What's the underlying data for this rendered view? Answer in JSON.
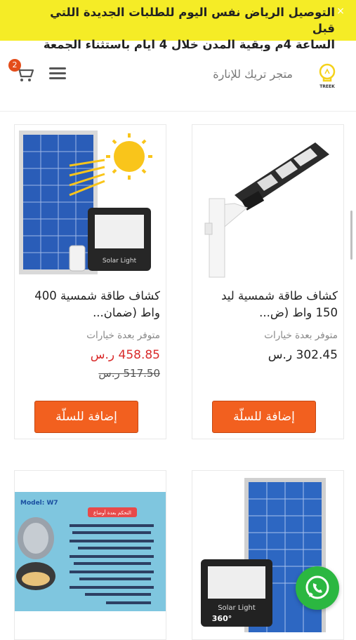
{
  "banner": {
    "message": "التوصيل الرياض نفس اليوم للطلبات الجديدة اللتي قبل\nالساعة 4م وبقية المدن خلال 4 ايام باستثناء الجمعة",
    "close_icon": "×"
  },
  "header": {
    "store_name": "متجر تريك للإنارة",
    "cart_count": "2",
    "logo_text": "TREEK"
  },
  "products": [
    {
      "title": "كشاف طاقة شمسية ليد\n150 واط (ض...",
      "availability": "متوفر بعدة خيارات",
      "price": "302.45 ر.س",
      "old_price": "",
      "add_button": "إضافة للسلّة"
    },
    {
      "title": "كشاف طاقة شمسية 400\nواط (ضمان...",
      "availability": "متوفر بعدة خيارات",
      "price": "458.85 ر.س",
      "old_price": "517.50 ر.س",
      "add_button": "إضافة للسلّة"
    },
    {
      "image_labels": [
        "Solar Light",
        "360°"
      ]
    },
    {
      "image_labels": [
        "Model: W7",
        "التحكم بعدة أوضاع"
      ]
    }
  ],
  "colors": {
    "banner": "#f5ec26",
    "accent": "#f2601f",
    "sale": "#d92b2b",
    "whatsapp": "#2bb741"
  },
  "icons": [
    "close-icon",
    "bulb-logo-icon",
    "hamburger-icon",
    "cart-icon",
    "whatsapp-icon"
  ]
}
